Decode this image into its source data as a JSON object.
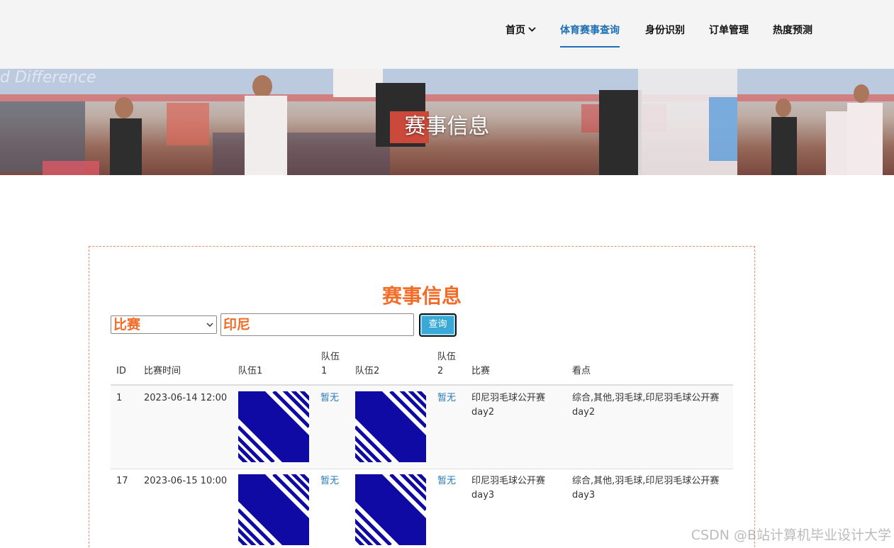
{
  "nav": {
    "items": [
      {
        "label": "首页"
      },
      {
        "label": "体育赛事查询"
      },
      {
        "label": "身份识别"
      },
      {
        "label": "订单管理"
      },
      {
        "label": "热度预测"
      }
    ]
  },
  "banner": {
    "title": "赛事信息",
    "sign_text": "d Difference"
  },
  "panel": {
    "title": "赛事信息"
  },
  "search": {
    "field_value": "比赛",
    "query_value": "印尼",
    "button_label": "查询"
  },
  "table": {
    "headers": [
      "ID",
      "比赛时间",
      "队伍1",
      "队伍\n1",
      "队伍2",
      "队伍\n2",
      "比赛",
      "看点"
    ],
    "rows": [
      {
        "id": "1",
        "time": "2023-06-14 12:00",
        "team1_logo": "team-logo-icon",
        "team1_name": "暂无",
        "team2_logo": "team-logo-icon",
        "team2_name": "暂无",
        "match": "印尼羽毛球公开赛day2",
        "highlights": "综合,其他,羽毛球,印尼羽毛球公开赛day2"
      },
      {
        "id": "17",
        "time": "2023-06-15 10:00",
        "team1_logo": "team-logo-icon",
        "team1_name": "暂无",
        "team2_logo": "team-logo-icon",
        "team2_name": "暂无",
        "match": "印尼羽毛球公开赛day3",
        "highlights": "综合,其他,羽毛球,印尼羽毛球公开赛day3"
      }
    ]
  },
  "watermark": "CSDN @B站计算机毕业设计大学",
  "colors": {
    "accent_orange": "#f26c28",
    "nav_active": "#1e6fb3",
    "link": "#2a7ab8",
    "button": "#3aa9d6",
    "logo_blue": "#0e0aa3"
  }
}
